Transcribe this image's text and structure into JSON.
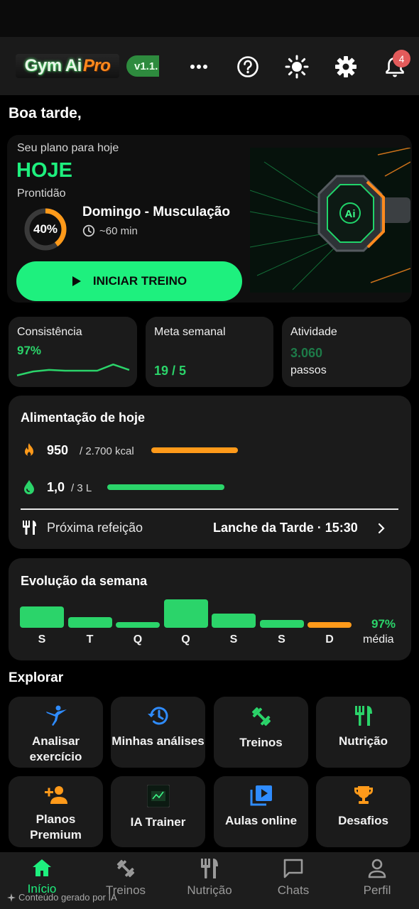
{
  "header": {
    "logo_main": "Gym Ai",
    "logo_accent": "Pro",
    "version": "v1.1.",
    "notification_count": "4"
  },
  "greeting": "Boa tarde,",
  "today": {
    "subtitle": "Seu plano para hoje",
    "title": "HOJE",
    "readiness_label": "Prontidão",
    "readiness_value": "40%",
    "readiness_fraction": 0.4,
    "workout_title": "Domingo - Musculação",
    "workout_duration": "~60 min",
    "start_label": "INICIAR TREINO"
  },
  "stats": {
    "consistency": {
      "title": "Consistência",
      "value": "97%",
      "sparkline": [
        0.2,
        0.45,
        0.55,
        0.5,
        0.5,
        0.5,
        0.9,
        0.55
      ]
    },
    "weekly_goal": {
      "title": "Meta semanal",
      "value": "19 / 5"
    },
    "activity": {
      "title": "Atividade",
      "value": "3.060",
      "unit": "passos"
    }
  },
  "food": {
    "title": "Alimentação de hoje",
    "calories_value": "950",
    "calories_total": "/ 2.700 kcal",
    "calories_fraction": 0.35,
    "water_value": "1,0",
    "water_total": "/ 3 L",
    "water_fraction": 0.33,
    "next_meal_label": "Próxima refeição",
    "next_meal_value": "Lanche da Tarde · 15:30"
  },
  "week": {
    "title": "Evolução da semana",
    "days": [
      "S",
      "T",
      "Q",
      "Q",
      "S",
      "S",
      "D"
    ],
    "levels": [
      0.75,
      0.37,
      0.2,
      1.0,
      0.5,
      0.27,
      0.2
    ],
    "highlight_index": 6,
    "average_value": "97%",
    "average_label": "média"
  },
  "explore": {
    "title": "Explorar",
    "tiles": [
      {
        "label": "Analisar exercício",
        "icon": "kick-icon"
      },
      {
        "label": "Minhas análises",
        "icon": "history-icon"
      },
      {
        "label": "Treinos",
        "icon": "dumbbell-icon"
      },
      {
        "label": "Nutrição",
        "icon": "utensils-icon"
      },
      {
        "label": "Planos Premium",
        "icon": "person-add-icon"
      },
      {
        "label": "IA Trainer",
        "icon": "ai-trainer-thumbnail"
      },
      {
        "label": "Aulas online",
        "icon": "video-library-icon"
      },
      {
        "label": "Desafios",
        "icon": "trophy-icon"
      }
    ]
  },
  "nav": {
    "items": [
      {
        "label": "Início",
        "active": true
      },
      {
        "label": "Treinos"
      },
      {
        "label": "Nutrição"
      },
      {
        "label": "Chats"
      },
      {
        "label": "Perfil"
      }
    ]
  },
  "ai_note": "Conteúdo gerado por IA",
  "colors": {
    "accent": "#1ef07e",
    "green": "#2bd46a",
    "orange": "#ff9a1a",
    "card": "#1b1b1b"
  }
}
